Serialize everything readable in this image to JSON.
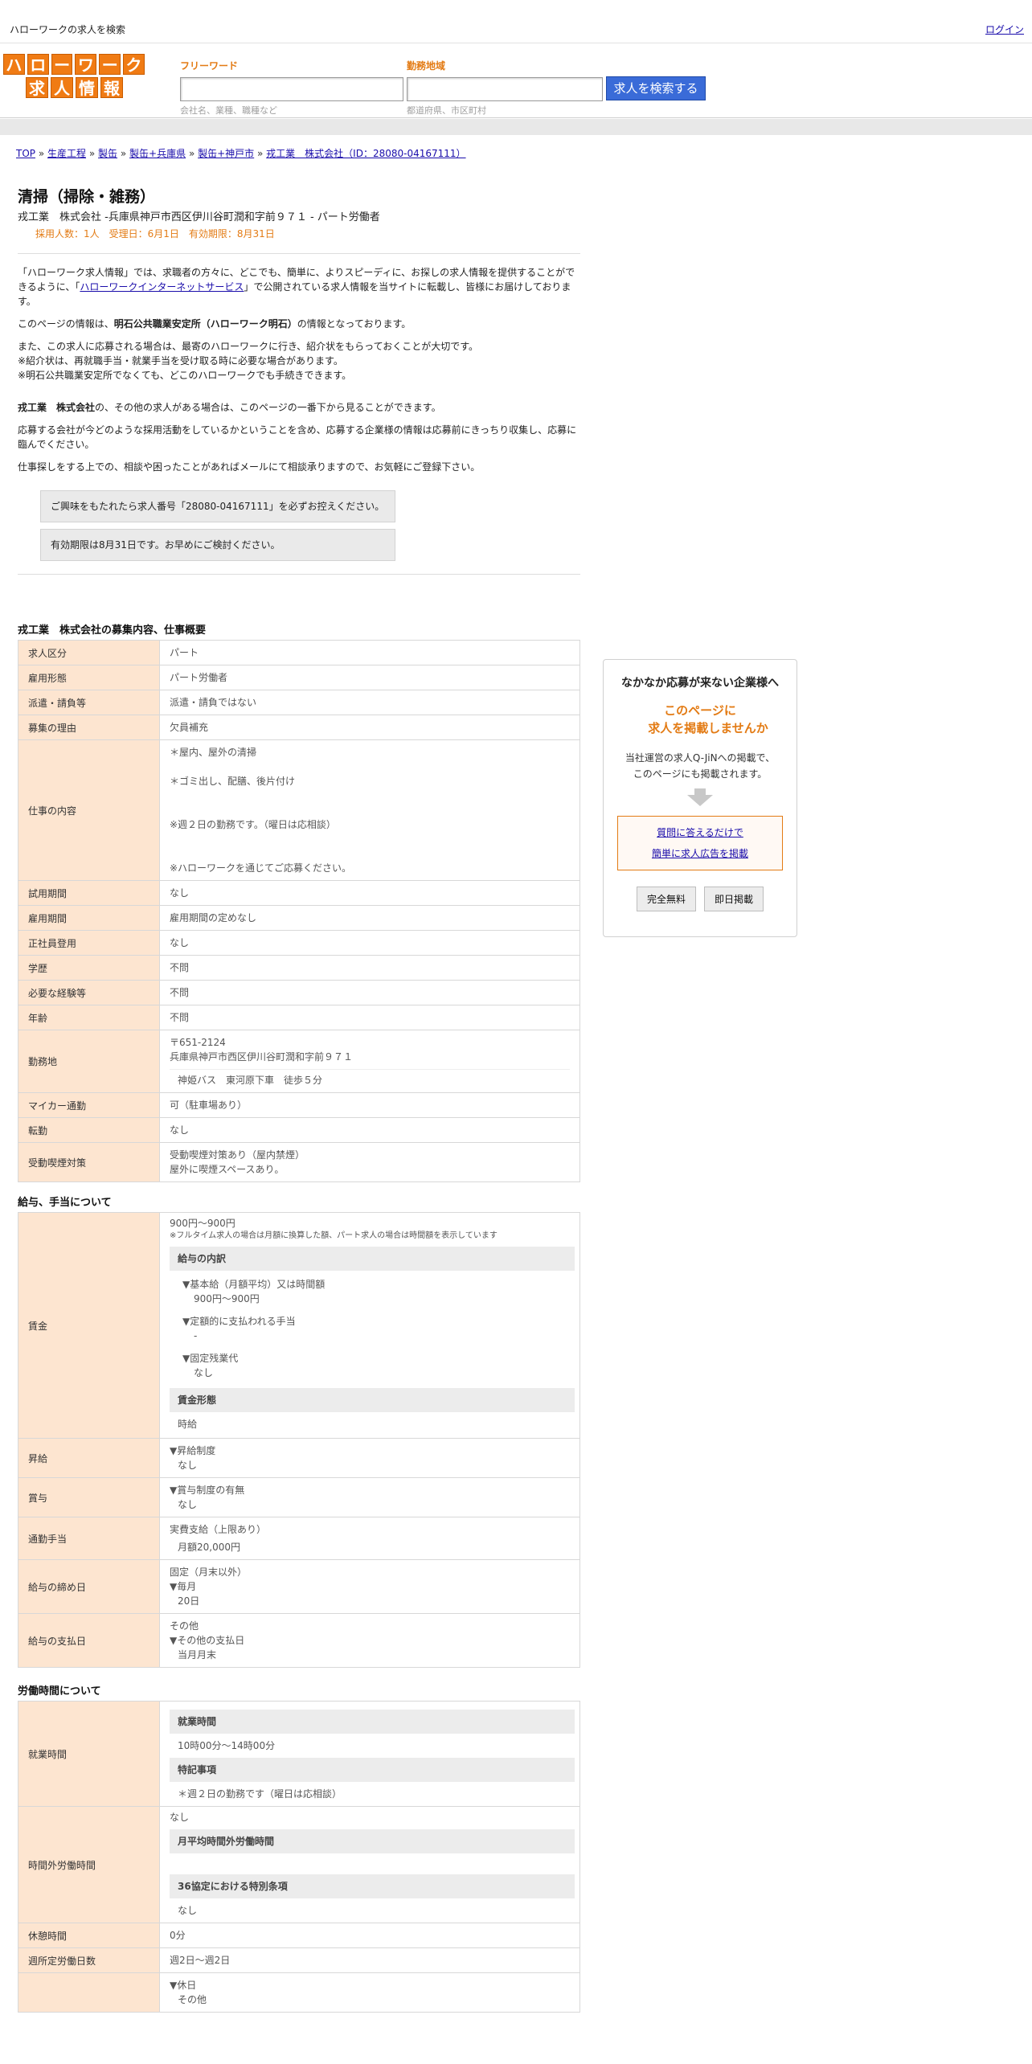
{
  "top": {
    "site_title": "ハローワークの求人を検索",
    "login": "ログイン"
  },
  "logo": {
    "row1": [
      "ハ",
      "ロ",
      "ー",
      "ワ",
      "ー",
      "ク"
    ],
    "row2": [
      "求",
      "人",
      "情",
      "報"
    ]
  },
  "search": {
    "free_label": "フリーワード",
    "free_value": "",
    "free_hint": "会社名、業種、職種など",
    "area_label": "勤務地域",
    "area_value": "",
    "area_hint": "都道府県、市区町村",
    "button": "求人を検索する"
  },
  "breadcrumb": [
    "TOP",
    "生産工程",
    "製缶",
    "製缶+兵庫県",
    "製缶+神戸市",
    "戎工業　株式会社（ID：28080-04167111）"
  ],
  "breadcrumb_sep": "»",
  "job": {
    "title": "清掃（掃除・雑務）",
    "subtitle": "戎工業　株式会社 -兵庫県神戸市西区伊川谷町潤和字前９７１ - パート労働者",
    "meta": "採用人数：1人　受理日：6月1日　有効期限：8月31日"
  },
  "intro": {
    "p1_a": "「ハローワーク求人情報」では、求職者の方々に、どこでも、簡単に、よりスピーディに、お探しの求人情報を提供することができるように、「",
    "p1_link": "ハローワークインターネットサービス",
    "p1_b": "」で公開されている求人情報を当サイトに転載し、皆様にお届けしております。",
    "p2_a": "このページの情報は、",
    "p2_bold": "明石公共職業安定所（ハローワーク明石）",
    "p2_b": "の情報となっております。",
    "p3_l1": "また、この求人に応募される場合は、最寄のハローワークに行き、紹介状をもらっておくことが大切です。",
    "p3_l2": "※紹介状は、再就職手当・就業手当を受け取る時に必要な場合があります。",
    "p3_l3": "※明石公共職業安定所でなくても、どこのハローワークでも手続きできます。",
    "p4_bold": "戎工業　株式会社",
    "p4_b": "の、その他の求人がある場合は、このページの一番下から見ることができます。",
    "p5": "応募する会社が今どのような採用活動をしているかということを含め、応募する企業様の情報は応募前にきっちり収集し、応募に臨んでください。",
    "p6": "仕事探しをする上での、相談や困ったことがあればメールにて相談承りますので、お気軽にご登録下さい。",
    "box1": "ご興味をもたれたら求人番号「28080-04167111」を必ずお控えください。",
    "box2": "有効期限は8月31日です。お早めにご検討ください。"
  },
  "section1": {
    "heading": "戎工業　株式会社の募集内容、仕事概要",
    "rows": [
      {
        "k": "求人区分",
        "v": "パート"
      },
      {
        "k": "雇用形態",
        "v": "パート労働者"
      },
      {
        "k": "派遣・請負等",
        "v": "派遣・請負ではない"
      },
      {
        "k": "募集の理由",
        "v": "欠員補充"
      },
      {
        "k": "仕事の内容",
        "v1": "＊屋内、屋外の清掃",
        "v2": "＊ゴミ出し、配膳、後片付け",
        "v3": "※週２日の勤務です。（曜日は応相談）",
        "v4": "※ハローワークを通じてご応募ください。"
      },
      {
        "k": "試用期間",
        "v": "なし"
      },
      {
        "k": "雇用期間",
        "v": "雇用期間の定めなし"
      },
      {
        "k": "正社員登用",
        "v": "なし"
      },
      {
        "k": "学歴",
        "v": "不問"
      },
      {
        "k": "必要な経験等",
        "v": "不問"
      },
      {
        "k": "年齢",
        "v": "不問"
      },
      {
        "k": "勤務地",
        "v1": "〒651-2124",
        "v2": "兵庫県神戸市西区伊川谷町潤和字前９７１",
        "v3": "神姫バス　東河原下車　徒歩５分"
      },
      {
        "k": "マイカー通勤",
        "v": "可（駐車場あり）"
      },
      {
        "k": "転勤",
        "v": "なし"
      },
      {
        "k": "受動喫煙対策",
        "v1": "受動喫煙対策あり（屋内禁煙）",
        "v2": "屋外に喫煙スペースあり。"
      }
    ]
  },
  "section2": {
    "heading": "給与、手当について",
    "wage_k": "賃金",
    "wage_range": "900円〜900円",
    "wage_note": "※フルタイム求人の場合は月額に換算した額、パート求人の場合は時間額を表示しています",
    "wage_breakdown": "給与の内訳",
    "base_label": "▼基本給（月額平均）又は時間額",
    "base_value": "900円〜900円",
    "fixed_label": "▼定額的に支払われる手当",
    "fixed_value": "-",
    "ot_label": "▼固定残業代",
    "ot_value": "なし",
    "wage_form_label": "賃金形態",
    "wage_form_value": "時給",
    "raise_k": "昇給",
    "raise_l": "▼昇給制度",
    "raise_v": "なし",
    "bonus_k": "賞与",
    "bonus_l": "▼賞与制度の有無",
    "bonus_v": "なし",
    "commute_k": "通勤手当",
    "commute_l": "実費支給（上限あり）",
    "commute_v": "月額20,000円",
    "close_k": "給与の締め日",
    "close_l": "固定（月末以外）",
    "close_l2": "▼毎月",
    "close_v": "20日",
    "pay_k": "給与の支払日",
    "pay_l": "その他",
    "pay_l2": "▼その他の支払日",
    "pay_v": "当月月末"
  },
  "section3": {
    "heading": "労働時間について",
    "hours_k": "就業時間",
    "hours_label": "就業時間",
    "hours_value": "10時00分〜14時00分",
    "special_label": "特記事項",
    "special_value": "＊週２日の勤務です（曜日は応相談）",
    "ot_k": "時間外労働時間",
    "ot_v": "なし",
    "ot_avg_label": "月平均時間外労働時間",
    "ot_36_label": "36協定における特別条項",
    "ot_36_value": "なし",
    "break_k": "休憩時間",
    "break_v": "0分",
    "days_k": "週所定労働日数",
    "days_v": "週2日〜週2日",
    "holiday_k": "",
    "holiday_l": "▼休日",
    "holiday_v": "その他"
  },
  "sidebar": {
    "heading": "なかなか応募が来ない企業様へ",
    "offer_l1": "このページに",
    "offer_l2": "求人を掲載しませんか",
    "desc_l1": "当社運営の求人Q-JiNへの掲載で、",
    "desc_l2": "このページにも掲載されます。",
    "link1": "質問に答えるだけで",
    "link2": "簡単に求人広告を掲載",
    "btn1": "完全無料",
    "btn2": "即日掲載"
  },
  "colors": {
    "accent": "#e37b14",
    "label_bg": "#fde5d0",
    "search_btn": "#3a6bd8",
    "link": "#1a0dab"
  }
}
